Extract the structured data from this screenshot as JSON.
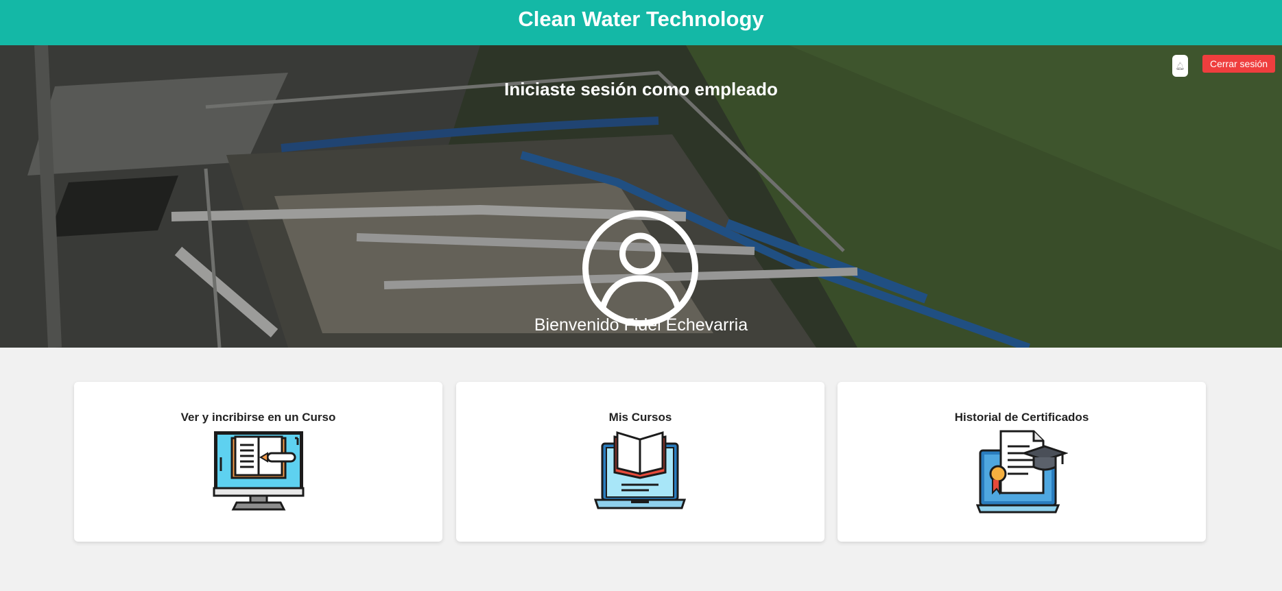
{
  "header": {
    "title": "Clean Water Technology"
  },
  "hero": {
    "session_title": "Iniciaste sesión como empleado",
    "welcome": "Bienvenido Fidel Echevarria",
    "avatar_icon": "user-circle-icon"
  },
  "toolbar": {
    "bell_icon": "bell-icon",
    "logout_label": "Cerrar sesión"
  },
  "cards": [
    {
      "title": "Ver y incribirse en un Curso",
      "icon": "computer-book-icon"
    },
    {
      "title": "Mis Cursos",
      "icon": "laptop-book-icon"
    },
    {
      "title": "Historial de Certificados",
      "icon": "laptop-certificate-icon"
    }
  ],
  "colors": {
    "header_bg": "#14b8a6",
    "logout_bg": "#ef3e3e",
    "page_bg": "#f1f1f1"
  }
}
